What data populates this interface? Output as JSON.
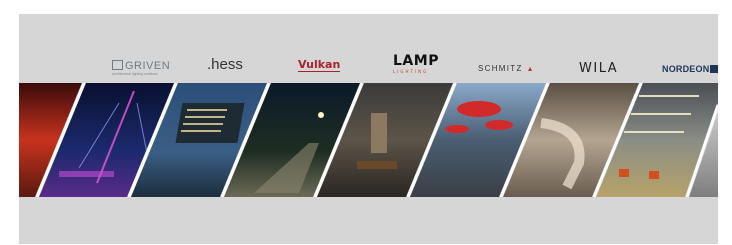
{
  "logos": {
    "griven": "GRIVEN",
    "griven_sub": "architectural lighting solutions",
    "hess": ".hess",
    "vulkan": "Vulkan",
    "lamp": "LAMP",
    "lamp_sub": "LIGHTING",
    "schmitz": "SCHMITZ",
    "wila": "WILA",
    "nordeon": "NORDEON"
  },
  "colors": {
    "background": "#d6d6d6",
    "vulkan_red": "#a8232c",
    "nordeon_blue": "#1d3557"
  },
  "photos": [
    "red-lit-building",
    "illuminated-bridge-night",
    "office-building-dusk",
    "street-lights-night",
    "restaurant-interior",
    "lobby-red-pendant-lights",
    "spiral-staircase",
    "industrial-hall",
    "warehouse"
  ]
}
